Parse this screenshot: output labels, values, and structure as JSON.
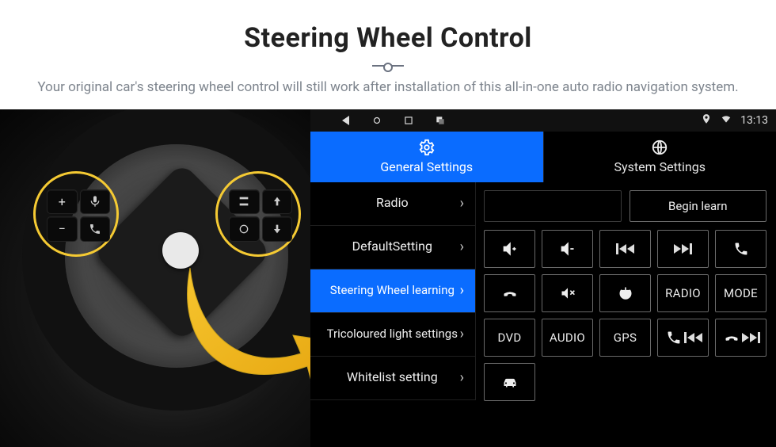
{
  "hero": {
    "title": "Steering Wheel Control",
    "subtitle": "Your original car's steering wheel control will still work after installation of this all-in-one auto radio navigation system."
  },
  "statusbar": {
    "time": "13:13"
  },
  "tabs": {
    "general": "General Settings",
    "system": "System Settings"
  },
  "sidebar": {
    "items": [
      {
        "label": "Radio"
      },
      {
        "label": "DefaultSetting"
      },
      {
        "label": "Steering Wheel learning"
      },
      {
        "label": "Tricoloured light settings"
      },
      {
        "label": "Whitelist setting"
      }
    ]
  },
  "content": {
    "begin_learn": "Begin learn",
    "buttons": {
      "radio": "RADIO",
      "mode": "MODE",
      "dvd": "DVD",
      "audio": "AUDIO",
      "gps": "GPS"
    }
  },
  "wheel": {
    "left_pads": [
      "+",
      "voice",
      "−",
      "phone"
    ],
    "right_pads": [
      "src",
      "up",
      "cycle",
      "down"
    ]
  }
}
